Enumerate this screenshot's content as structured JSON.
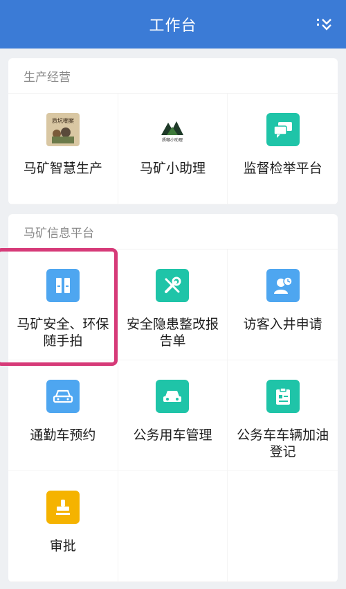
{
  "header": {
    "title": "工作台"
  },
  "sections": [
    {
      "title": "生产经营",
      "items": [
        {
          "label": "马矿智慧生产",
          "icon": "mine-photo-icon",
          "icon_text": "质坑嘲案"
        },
        {
          "label": "马矿小助理",
          "icon": "mountain-logo-icon",
          "icon_text": "质嘲小助理"
        },
        {
          "label": "监督检举平台",
          "icon": "chat-bubbles-icon",
          "color": "#1fc4a8"
        }
      ]
    },
    {
      "title": "马矿信息平台",
      "items": [
        {
          "label": "马矿安全、环保随手拍",
          "icon": "folder-pair-icon",
          "color": "#4ea6f0"
        },
        {
          "label": "安全隐患整改报告单",
          "icon": "tools-icon",
          "color": "#1fc4a8"
        },
        {
          "label": "访客入井申请",
          "icon": "visitor-icon",
          "color": "#4ea6f0"
        },
        {
          "label": "通勤车预约",
          "icon": "car-icon",
          "color": "#4ea6f0"
        },
        {
          "label": "公务用车管理",
          "icon": "car-icon",
          "color": "#1fc4a8"
        },
        {
          "label": "公务车车辆加油登记",
          "icon": "clipboard-icon",
          "color": "#1fc4a8"
        },
        {
          "label": "审批",
          "icon": "stamp-icon",
          "color": "#f5b300"
        }
      ]
    }
  ],
  "colors": {
    "header": "#3b7bd6",
    "highlight": "#d63a78"
  }
}
